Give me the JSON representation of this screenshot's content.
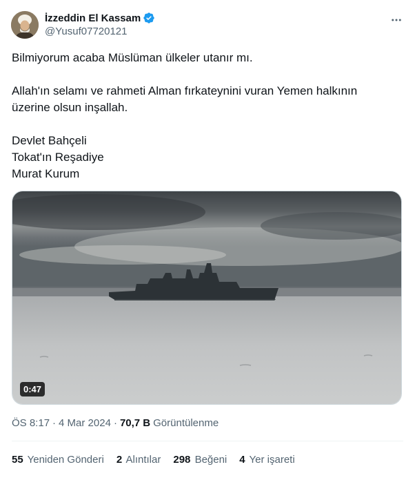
{
  "author": {
    "display_name": "İzzeddin El Kassam",
    "handle": "@Yusuf07720121",
    "verified_icon": "verified-badge-icon",
    "badge_color": "#1d9bf0"
  },
  "tweet": {
    "lines": [
      "Bilmiyorum acaba Müslüman ülkeler utanır mı.",
      "Allah'ın selamı ve rahmeti Alman fırkateynini vuran Yemen halkının",
      "üzerine olsun inşallah.",
      "Devlet Bahçeli",
      "Tokat'ın Reşadiye",
      "Murat Kurum"
    ]
  },
  "media": {
    "type": "video",
    "duration": "0:47"
  },
  "meta": {
    "time": "ÖS 8:17",
    "separator": "·",
    "date": "4 Mar 2024",
    "views_count": "70,7 B",
    "views_label": "Görüntülenme"
  },
  "stats": {
    "retweets": {
      "count": "55",
      "label": "Yeniden Gönderi"
    },
    "quotes": {
      "count": "2",
      "label": "Alıntılar"
    },
    "likes": {
      "count": "298",
      "label": "Beğeni"
    },
    "bookmarks": {
      "count": "4",
      "label": "Yer işareti"
    }
  }
}
